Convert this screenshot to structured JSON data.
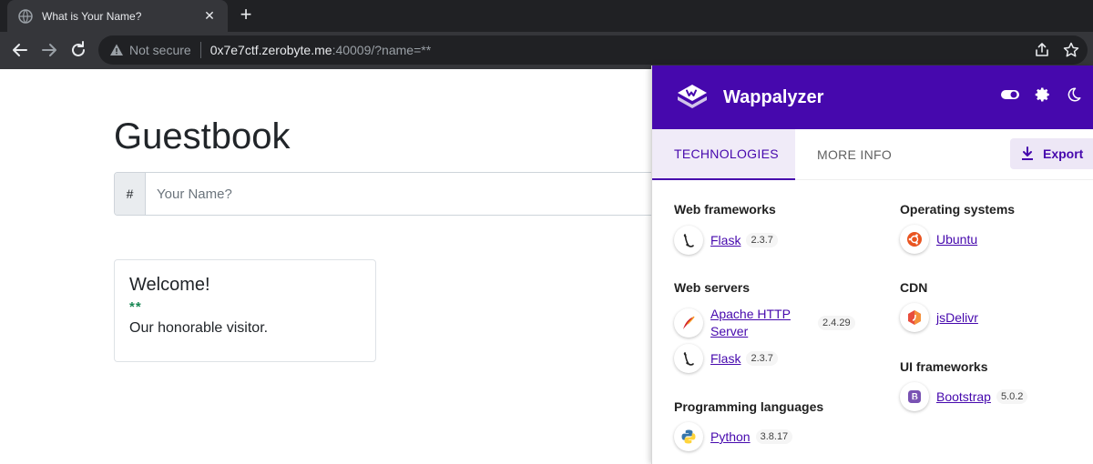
{
  "browser": {
    "tab_title": "What is Your Name?",
    "url_not_secure": "Not secure",
    "url_host": "0x7e7ctf.zerobyte.me",
    "url_rest": ":40009/?name=**"
  },
  "page": {
    "title": "Guestbook",
    "input_prefix": "#",
    "input_placeholder": "Your Name?",
    "card": {
      "heading": "Welcome!",
      "name": "**",
      "body": "Our honorable visitor."
    }
  },
  "wappalyzer": {
    "brand": "Wappalyzer",
    "tabs": {
      "technologies": "TECHNOLOGIES",
      "more_info": "MORE INFO"
    },
    "export_label": "Export",
    "categories": {
      "web_frameworks": {
        "label": "Web frameworks",
        "items": [
          {
            "name": "Flask",
            "version": "2.3.7"
          }
        ]
      },
      "web_servers": {
        "label": "Web servers",
        "items": [
          {
            "name": "Apache HTTP Server",
            "version": "2.4.29"
          },
          {
            "name": "Flask",
            "version": "2.3.7"
          }
        ]
      },
      "programming_languages": {
        "label": "Programming languages",
        "items": [
          {
            "name": "Python",
            "version": "3.8.17"
          }
        ]
      },
      "operating_systems": {
        "label": "Operating systems",
        "items": [
          {
            "name": "Ubuntu"
          }
        ]
      },
      "cdn": {
        "label": "CDN",
        "items": [
          {
            "name": "jsDelivr"
          }
        ]
      },
      "ui_frameworks": {
        "label": "UI frameworks",
        "items": [
          {
            "name": "Bootstrap",
            "version": "5.0.2"
          }
        ]
      }
    }
  },
  "colors": {
    "wappalyzer_purple": "#4608ad",
    "bootstrap_success": "#198754",
    "chrome_dark": "#202124"
  }
}
